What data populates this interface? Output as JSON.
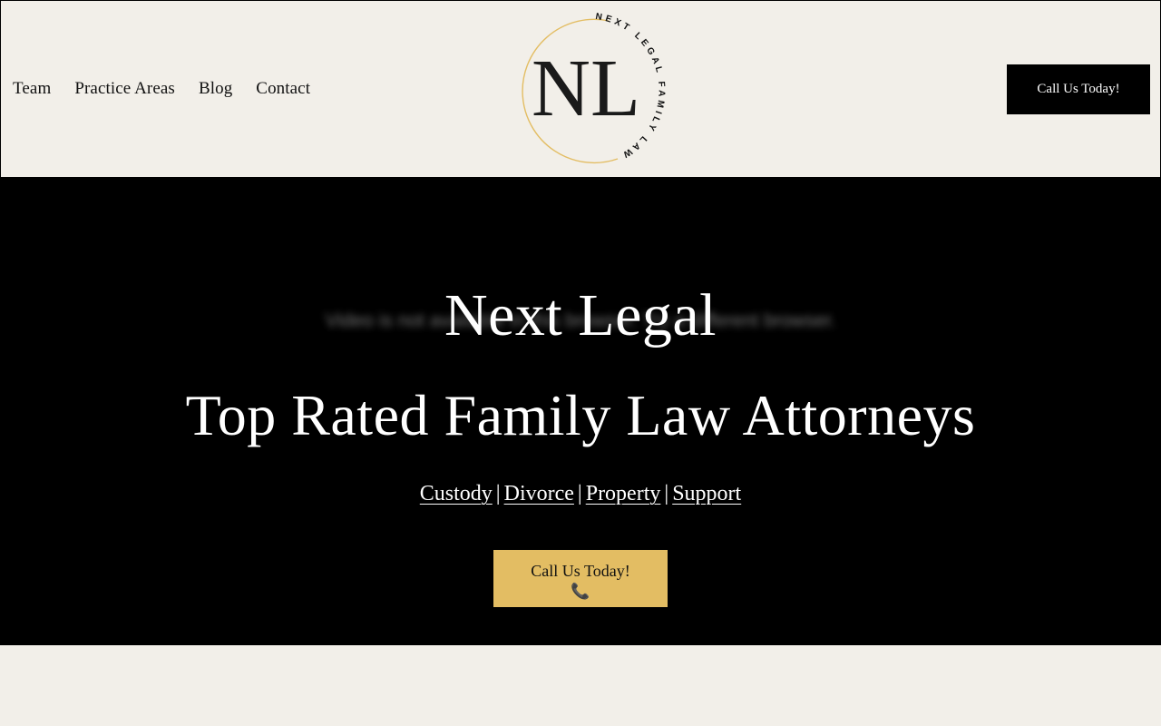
{
  "nav": {
    "items": [
      "Team",
      "Practice Areas",
      "Blog",
      "Contact"
    ]
  },
  "logo": {
    "monogram": "NL",
    "ring_text": "NEXT LEGAL FAMILY LAW",
    "ring_color": "#e3bd63"
  },
  "header": {
    "cta_label": "Call Us Today!"
  },
  "hero": {
    "video_message": "Video is not available in this browser. Try a different browser.",
    "title": "Next Legal",
    "subtitle": "Top Rated Family Law Attorneys",
    "services": [
      "Custody",
      "Divorce",
      "Property",
      "Support"
    ],
    "separator": "|",
    "cta_label": "Call Us Today!",
    "cta_icon": "phone-icon",
    "cta_icon_glyph": "📞",
    "cta_color": "#e3bd63"
  },
  "colors": {
    "background": "#f2efe9",
    "hero_background": "#000000",
    "button_dark": "#000000",
    "accent": "#e3bd63"
  }
}
